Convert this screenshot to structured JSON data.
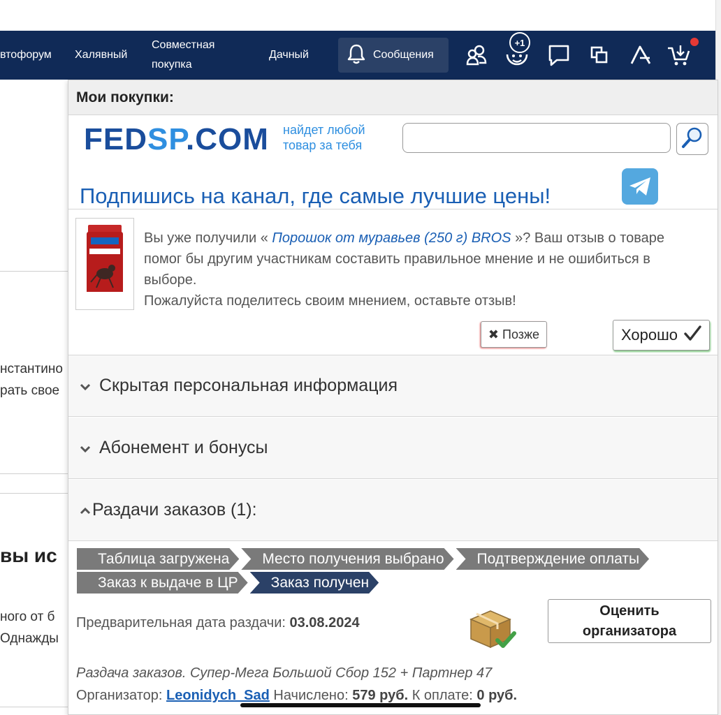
{
  "nav": {
    "items": [
      "втофорум",
      "Халявный",
      "Совместная",
      "покупка",
      "Дачный"
    ],
    "messages_label": "Сообщения",
    "badge": "+1"
  },
  "background": {
    "text1": "нстантино",
    "text2": "рать свое",
    "heading": "вы ис",
    "text3": "ного от б",
    "text4": "Однажды"
  },
  "panel": {
    "title": "Мои покупки:",
    "brand_part1": "FED",
    "brand_part2": "SP",
    "brand_part3": ".COM",
    "tagline_line1": "найдет любой",
    "tagline_line2": "товар за тебя",
    "search_value": "",
    "subscribe_text": "Подпишись на канал, где самые лучшие цены!"
  },
  "review": {
    "prefix": "Вы уже получили «",
    "product_link": "Порошок от муравьев (250 г) BROS",
    "suffix": "»? Ваш отзыв о товаре помог бы другим участникам составить правильное мнение и не ошибиться в выборе.",
    "line2": "Пожалуйста поделитесь своим мнением, оставьте отзыв!",
    "later_label": "Позже",
    "ok_label": "Хорошо"
  },
  "sections": {
    "hidden_info": "Скрытая персональная информация",
    "subscription": "Абонемент и бонусы",
    "distributions": "Раздачи заказов (1):"
  },
  "steps": {
    "row1": [
      "Таблица загружена",
      "Место получения выбрано",
      "Подтверждение оплаты"
    ],
    "row2": [
      "Заказ к выдаче в ЦР",
      "Заказ получен"
    ]
  },
  "order": {
    "date_label": "Предварительная дата раздачи:",
    "date_value": "03.08.2024",
    "rate_line1": "Оценить",
    "rate_line2": "организатора",
    "dist_title": "Раздача заказов. Супер-Мега Большой Сбор 152 + Партнер 47",
    "organizer_label": "Организатор:",
    "organizer_name": "Leonidych_Sad",
    "charged_label": "Начислено:",
    "charged_value": "579 руб.",
    "to_pay_label": "К оплате:",
    "to_pay_value": "0 руб."
  },
  "colors": {
    "navbar": "#102a57",
    "brand_dark": "#1a4d9c",
    "brand_light": "#2f8fe0",
    "link": "#1a5fb4",
    "step_done": "#7a7a7a",
    "step_active": "#2b4167"
  },
  "icons": [
    "bell-icon",
    "users-icon",
    "smile-plus-icon",
    "chat-icon",
    "copy-icon",
    "font-icon",
    "cart-icon",
    "search-icon",
    "telegram-icon",
    "chevron-down-icon",
    "chevron-up-icon",
    "close-icon",
    "checkmark-icon",
    "box-check-icon"
  ]
}
